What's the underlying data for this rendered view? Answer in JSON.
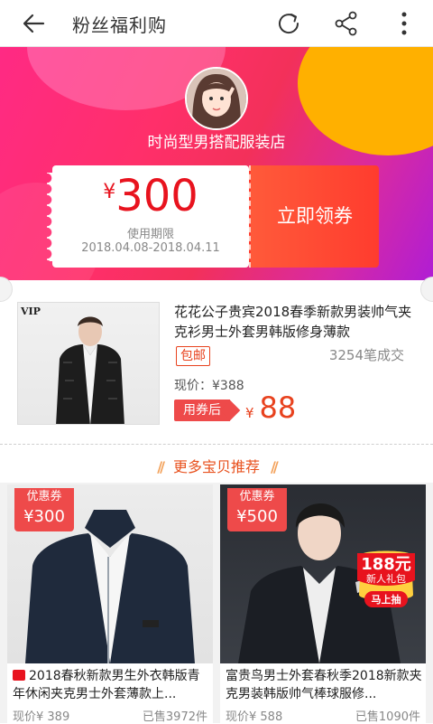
{
  "topbar": {
    "title": "粉丝福利购"
  },
  "shop": {
    "name": "时尚型男搭配服装店"
  },
  "coupon": {
    "currency": "¥",
    "amount": "300",
    "validity_label": "使用期限",
    "dates": "2018.04.08-2018.04.11",
    "claim_label": "立即领券"
  },
  "product": {
    "brand_text": "VIP",
    "title": "花花公子贵宾2018春季新款男装帅气夹克衫男士外套男韩版修身薄款",
    "free_shipping": "包邮",
    "sold": "3254笔成交",
    "now_price": "现价：¥388",
    "after_coupon_label": "用券后",
    "after_currency": "¥",
    "after_price": "88"
  },
  "more": {
    "label": "更多宝贝推荐"
  },
  "cards": [
    {
      "badge_label": "优惠券",
      "badge_amount": "¥300",
      "title": "2018春秋新款男生外衣韩版青年休闲夹克男士外套薄款上...",
      "price": "现价¥ 389",
      "sold": "已售3972件"
    },
    {
      "badge_label": "优惠券",
      "badge_amount": "¥500",
      "title": "富贵鸟男士外套春秋季2018新款夹克男装韩版帅气棒球服修...",
      "price": "现价¥ 588",
      "sold": "已售1090件",
      "gift_line1": "188元",
      "gift_line2": "新人礼包",
      "gift_line3": "马上抽"
    }
  ],
  "colors": {
    "accent_red": "#e8131e",
    "orange": "#e8511e",
    "hero_pink": "#ff2a84",
    "hero_purple": "#b01dd4",
    "hero_yellow": "#ffb000"
  }
}
